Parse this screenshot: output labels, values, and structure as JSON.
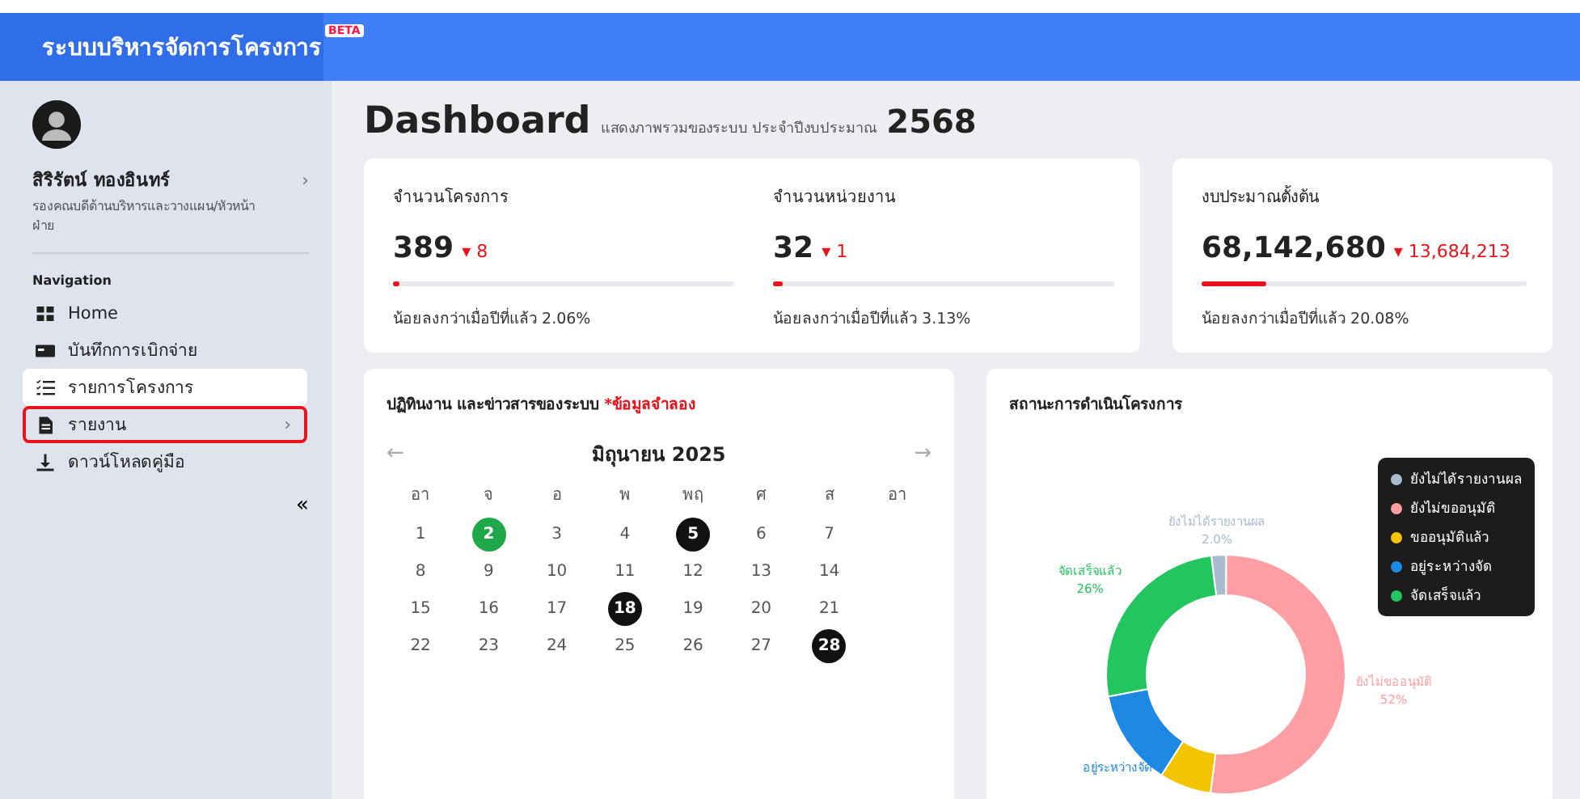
{
  "header": {
    "title": "ระบบบริหารจัดการโครงการ",
    "badge": "BETA"
  },
  "sidebar": {
    "user": {
      "name": "สิริรัตน์ ทองอินทร์",
      "chevron": "›",
      "role": "รองคณบดีด้านบริหารและวางแผน/หัวหน้าฝ่าย"
    },
    "section_title": "Navigation",
    "items": [
      {
        "label": "Home",
        "selected": false,
        "highlighted": false
      },
      {
        "label": "บันทึกการเบิกจ่าย",
        "selected": false,
        "highlighted": false
      },
      {
        "label": "รายการโครงการ",
        "selected": true,
        "highlighted": false
      },
      {
        "label": "รายงาน",
        "selected": false,
        "highlighted": true,
        "chevron": "›"
      },
      {
        "label": "ดาวน์โหลดคู่มือ",
        "selected": false,
        "highlighted": false
      }
    ],
    "collapse": "«"
  },
  "page": {
    "title": "Dashboard",
    "subtitle": "แสดงภาพรวมของระบบ ประจำปีงบประมาณ",
    "year": "2568"
  },
  "stats": [
    {
      "label": "จำนวนโครงการ",
      "value": "389",
      "arrow": "▾",
      "change": "8",
      "level": 0.02,
      "note": "น้อยลงกว่าเมื่อปีที่แล้ว 2.06%"
    },
    {
      "label": "จำนวนหน่วยงาน",
      "value": "32",
      "arrow": "▾",
      "change": "1",
      "level": 0.03,
      "note": "น้อยลงกว่าเมื่อปีที่แล้ว 3.13%"
    },
    {
      "label": "งบประมาณตั้งต้น",
      "value": "68,142,680",
      "arrow": "▾",
      "change": "13,684,213",
      "level": 0.2,
      "note": "น้อยลงกว่าเมื่อปีที่แล้ว 20.08%"
    }
  ],
  "calendar": {
    "title": "ปฏิทินงาน และข่าวสารของระบบ",
    "title_note": "*ข้อมูลจำลอง",
    "prev": "←",
    "month": "มิถุนายน 2025",
    "next": "→",
    "weekdays": [
      "อา",
      "จ",
      "อ",
      "พ",
      "พฤ",
      "ศ",
      "ส",
      "อา"
    ],
    "weeks": [
      [
        {
          "day": "1",
          "kind": "normal"
        },
        {
          "day": "2",
          "kind": "today"
        },
        {
          "day": "3",
          "kind": "normal"
        },
        {
          "day": "4",
          "kind": "normal"
        },
        {
          "day": "5",
          "kind": "event"
        },
        {
          "day": "6",
          "kind": "normal"
        },
        {
          "day": "7",
          "kind": "normal"
        }
      ],
      [
        {
          "day": "8",
          "kind": "normal"
        },
        {
          "day": "9",
          "kind": "normal"
        },
        {
          "day": "10",
          "kind": "normal"
        },
        {
          "day": "11",
          "kind": "normal"
        },
        {
          "day": "12",
          "kind": "normal"
        },
        {
          "day": "13",
          "kind": "normal"
        },
        {
          "day": "14",
          "kind": "normal"
        }
      ],
      [
        {
          "day": "15",
          "kind": "normal"
        },
        {
          "day": "16",
          "kind": "normal"
        },
        {
          "day": "17",
          "kind": "normal"
        },
        {
          "day": "18",
          "kind": "event"
        },
        {
          "day": "19",
          "kind": "normal"
        },
        {
          "day": "20",
          "kind": "normal"
        },
        {
          "day": "21",
          "kind": "normal"
        }
      ],
      [
        {
          "day": "22",
          "kind": "normal"
        },
        {
          "day": "23",
          "kind": "normal"
        },
        {
          "day": "24",
          "kind": "normal"
        },
        {
          "day": "25",
          "kind": "normal"
        },
        {
          "day": "26",
          "kind": "normal"
        },
        {
          "day": "27",
          "kind": "normal"
        },
        {
          "day": "28",
          "kind": "event"
        }
      ]
    ]
  },
  "status_chart": {
    "title": "สถานะการดำเนินโครงการ",
    "chart_data": {
      "type": "donut",
      "categories": [
        "ยังไม่ได้รายงานผล",
        "ยังไม่ขออนุมัติ",
        "ขออนุมัติแล้ว",
        "อยู่ระหว่างจัด",
        "จัดเสร็จแล้ว"
      ],
      "values": [
        2,
        52,
        7,
        13,
        26
      ],
      "colors": [
        "#a9bccf",
        "#ff9ea2",
        "#f5c400",
        "#1e88e5",
        "#22c55e"
      ]
    },
    "slice_labels": [
      {
        "text": "ยังไม่ได้รายงานผล",
        "value": "2.0%",
        "color": "#a9bccf"
      },
      {
        "text": "ยังไม่ขออนุมัติ",
        "value": "52%",
        "color": "#ff9ea2"
      },
      {
        "text": "อยู่ระหว่างจัด",
        "color": "#1e88e5"
      },
      {
        "text": "จัดเสร็จแล้ว",
        "value": "26%",
        "color": "#22c55e"
      }
    ]
  }
}
